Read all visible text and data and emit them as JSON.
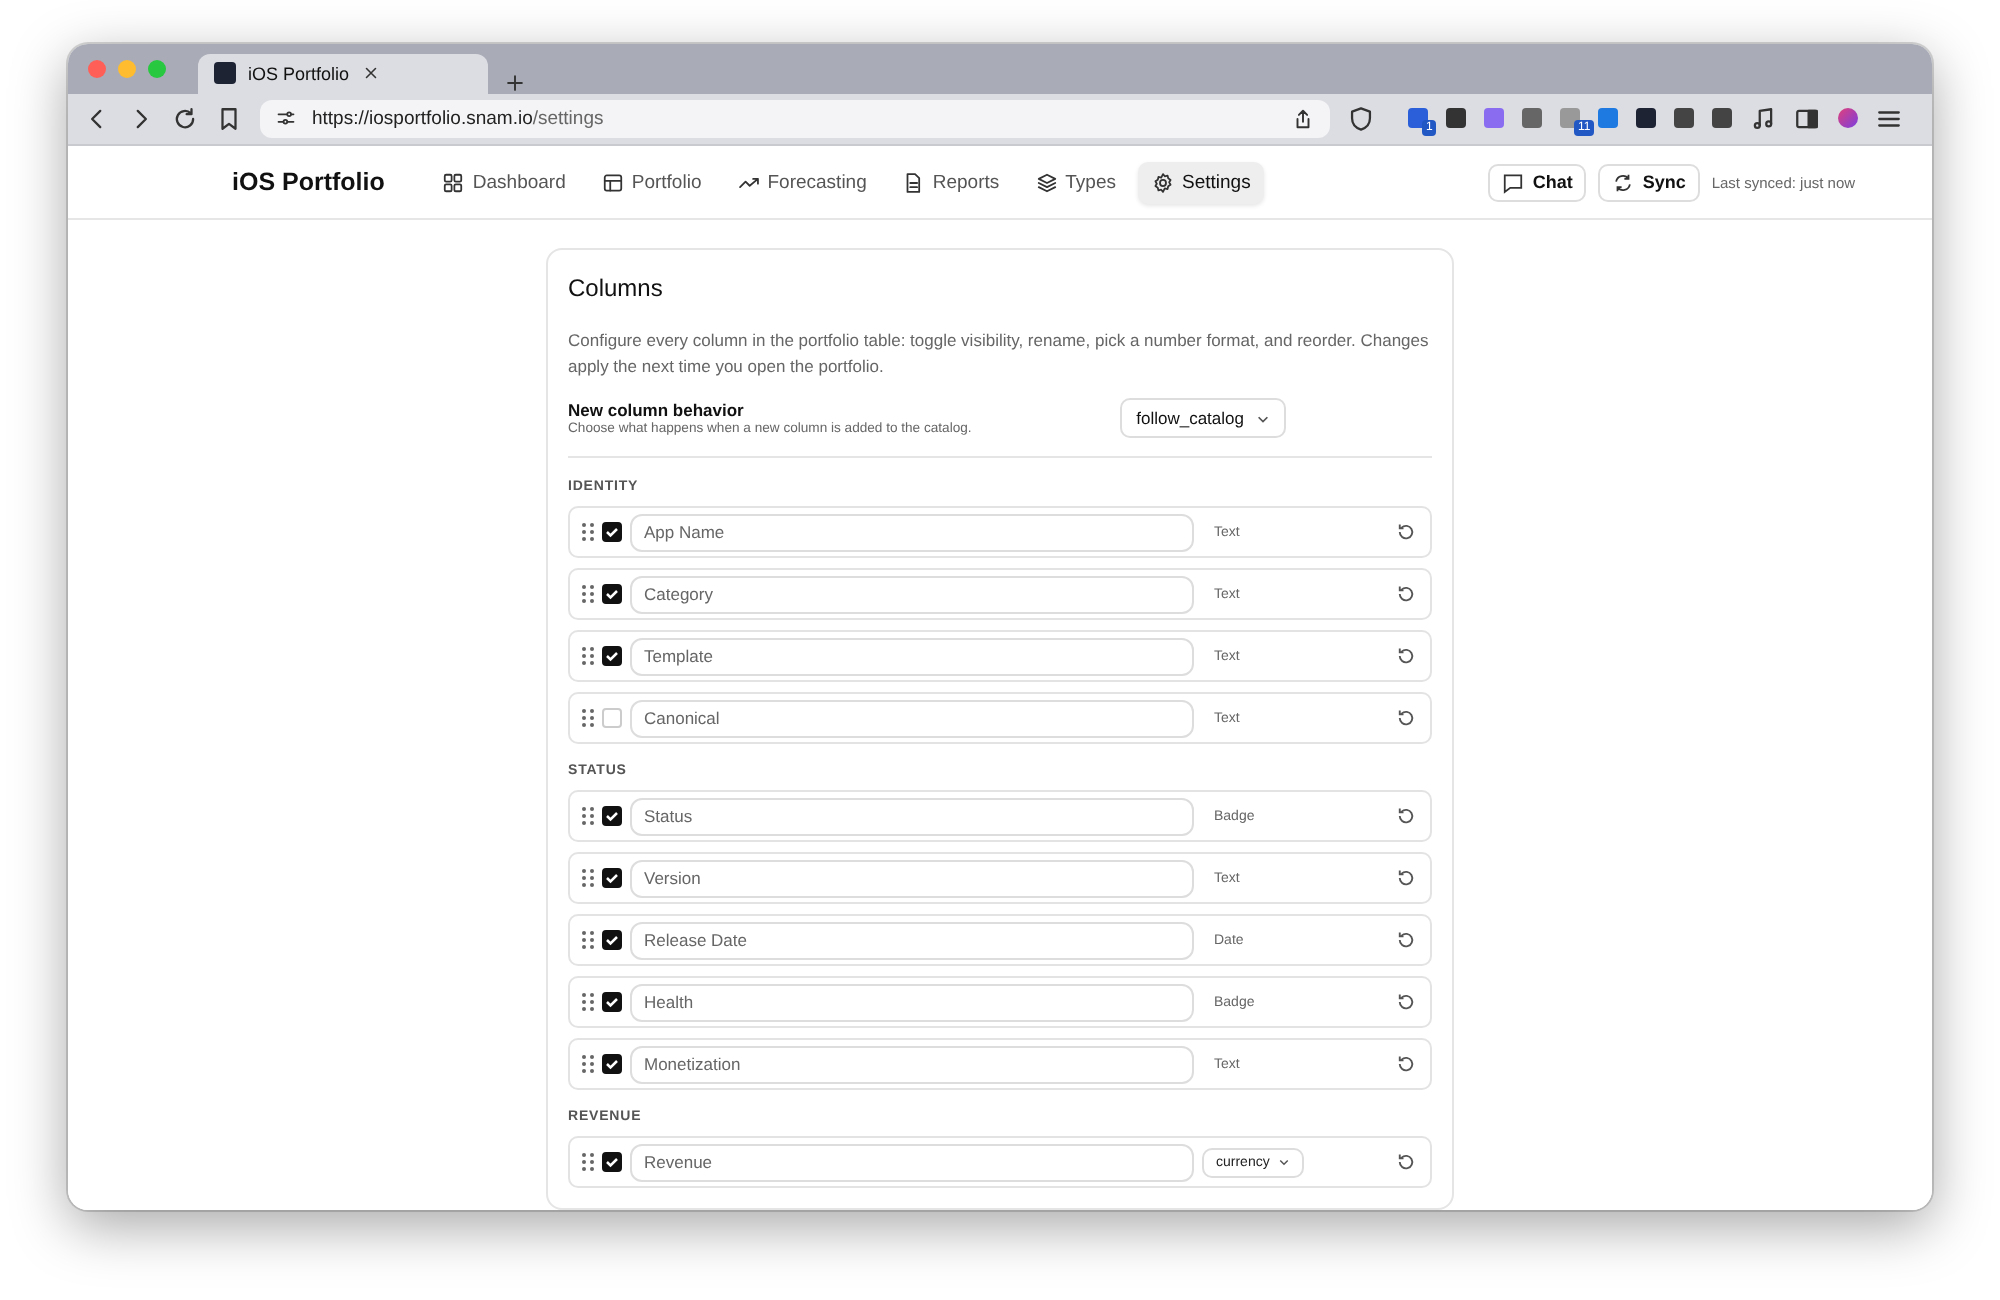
{
  "browser": {
    "tab_title": "iOS Portfolio",
    "url_host": "https://iosportfolio.snam.io",
    "url_path": "/settings",
    "extension_badges": [
      "1",
      "11"
    ]
  },
  "app": {
    "brand": "iOS Portfolio",
    "nav": [
      {
        "label": "Dashboard",
        "selected": false
      },
      {
        "label": "Portfolio",
        "selected": false
      },
      {
        "label": "Forecasting",
        "selected": false
      },
      {
        "label": "Reports",
        "selected": false
      },
      {
        "label": "Types",
        "selected": false
      },
      {
        "label": "Settings",
        "selected": true
      }
    ],
    "chat_button": "Chat",
    "sync_button": "Sync",
    "last_synced": "Last synced: just now"
  },
  "card": {
    "title": "Columns",
    "description": "Configure every column in the portfolio table: toggle visibility, rename, pick a number format, and reorder. Changes apply the next time you open the portfolio.",
    "new_column": {
      "label": "New column behavior",
      "hint": "Choose what happens when a new column is added to the catalog.",
      "value": "follow_catalog"
    },
    "groups": [
      {
        "heading": "IDENTITY",
        "columns": [
          {
            "kind": "label",
            "placeholder": "App Name",
            "visible": true,
            "type": "Text"
          },
          {
            "kind": "label",
            "placeholder": "Category",
            "visible": true,
            "type": "Text"
          },
          {
            "kind": "label",
            "placeholder": "Template",
            "visible": true,
            "type": "Text"
          },
          {
            "kind": "label",
            "placeholder": "Canonical",
            "visible": false,
            "type": "Text"
          }
        ]
      },
      {
        "heading": "STATUS",
        "columns": [
          {
            "kind": "label",
            "placeholder": "Status",
            "visible": true,
            "type": "Badge"
          },
          {
            "kind": "label",
            "placeholder": "Version",
            "visible": true,
            "type": "Text"
          },
          {
            "kind": "label",
            "placeholder": "Release Date",
            "visible": true,
            "type": "Date"
          },
          {
            "kind": "label",
            "placeholder": "Health",
            "visible": true,
            "type": "Badge"
          },
          {
            "kind": "label",
            "placeholder": "Monetization",
            "visible": true,
            "type": "Text"
          }
        ]
      },
      {
        "heading": "REVENUE",
        "columns": [
          {
            "kind": "select",
            "placeholder": "Revenue",
            "visible": true,
            "type": "currency"
          }
        ]
      }
    ]
  }
}
